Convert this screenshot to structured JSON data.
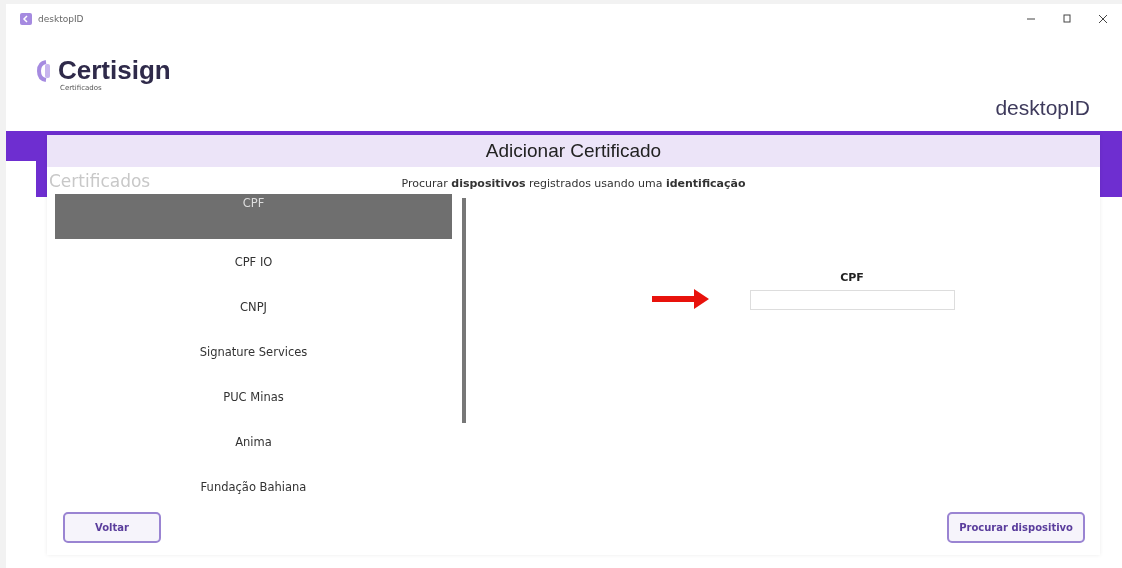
{
  "window": {
    "title": "desktopID"
  },
  "header": {
    "brand": "Certisign",
    "brand_subtitle": "Certificados",
    "product": "desktopID"
  },
  "background": {
    "heading": "Certificados"
  },
  "dialog": {
    "title": "Adicionar Certificado",
    "subtitle": "Procurar **dispositivos** registrados usando uma **identificação**",
    "id_types": [
      {
        "label": "CPF",
        "selected": true
      },
      {
        "label": "CPF IO",
        "selected": false
      },
      {
        "label": "CNPJ",
        "selected": false
      },
      {
        "label": "Signature Services",
        "selected": false
      },
      {
        "label": "PUC Minas",
        "selected": false
      },
      {
        "label": "Anima",
        "selected": false
      },
      {
        "label": "Fundação Bahiana",
        "selected": false
      }
    ],
    "field": {
      "label": "CPF"
    },
    "buttons": {
      "back": "Voltar",
      "search": "Procurar dispositivo"
    }
  }
}
